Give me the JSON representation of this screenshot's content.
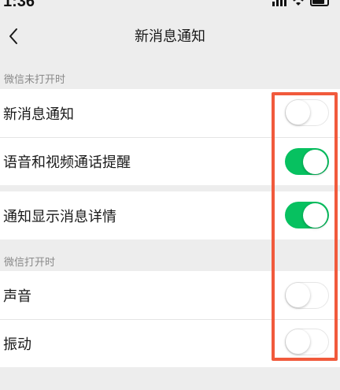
{
  "status_bar": {
    "time": "1:36"
  },
  "nav": {
    "title": "新消息通知"
  },
  "sections": [
    {
      "header": "微信未打开时",
      "rows": [
        {
          "label": "新消息通知",
          "on": false
        },
        {
          "label": "语音和视频通话提醒",
          "on": true
        }
      ]
    },
    {
      "header": "",
      "rows": [
        {
          "label": "通知显示消息详情",
          "on": true
        }
      ]
    },
    {
      "header": "微信打开时",
      "rows": [
        {
          "label": "声音",
          "on": false
        },
        {
          "label": "振动",
          "on": false
        }
      ]
    }
  ],
  "colors": {
    "toggle_on": "#07c160",
    "background": "#ededed",
    "highlight": "#f15a3c"
  }
}
